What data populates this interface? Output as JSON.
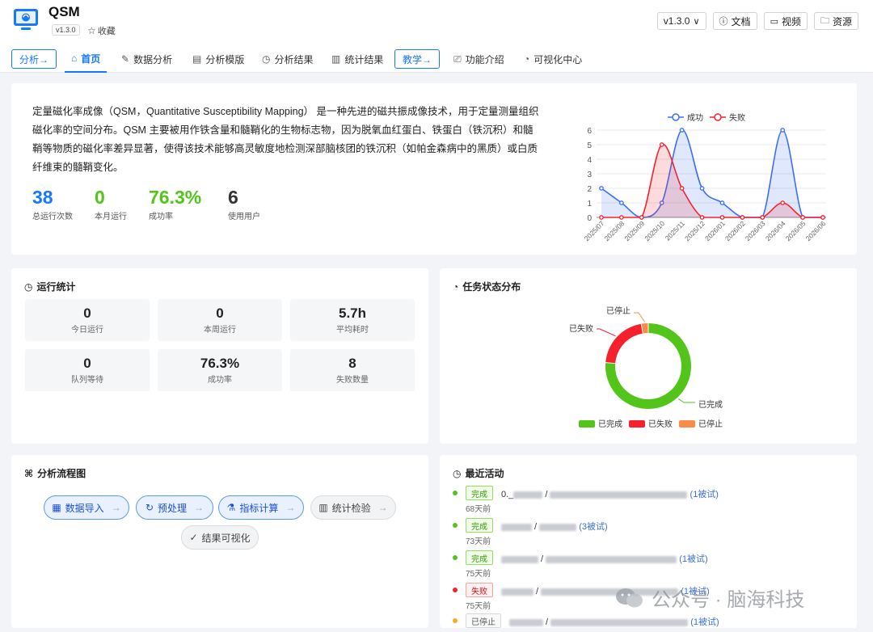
{
  "header": {
    "title": "QSM",
    "version_badge": "v1.3.0",
    "favorite_label": "收藏",
    "version_select": "v1.3.0",
    "docs_label": "文档",
    "video_label": "视频",
    "resources_label": "资源"
  },
  "nav": {
    "analysis_btn": "分析→",
    "home": "首页",
    "data_analysis": "数据分析",
    "analysis_template": "分析模版",
    "analysis_results": "分析结果",
    "stats_results": "统计结果",
    "teaching_btn": "教学→",
    "features": "功能介绍",
    "viz_center": "可视化中心"
  },
  "intro": {
    "description": "定量磁化率成像（QSM，Quantitative Susceptibility Mapping） 是一种先进的磁共振成像技术，用于定量测量组织磁化率的空间分布。QSM 主要被用作铁含量和髓鞘化的生物标志物，因为脱氧血红蛋白、铁蛋白（铁沉积）和髓鞘等物质的磁化率差异显著，使得该技术能够高灵敏度地检测深部脑核团的铁沉积（如帕金森病中的黑质）或白质纤维束的髓鞘变化。",
    "kpis": [
      {
        "value": "38",
        "label": "总运行次数",
        "color": "#1677ff"
      },
      {
        "value": "0",
        "label": "本月运行",
        "color": "#52c41a"
      },
      {
        "value": "76.3%",
        "label": "成功率",
        "color": "#52c41a"
      },
      {
        "value": "6",
        "label": "使用用户",
        "color": "#333333"
      }
    ]
  },
  "chart_data": {
    "type": "line",
    "categories": [
      "2025/07",
      "2025/08",
      "2025/09",
      "2025/10",
      "2025/11",
      "2025/12",
      "2026/01",
      "2026/02",
      "2026/03",
      "2026/04",
      "2026/05",
      "2026/06"
    ],
    "series": [
      {
        "name": "成功",
        "values": [
          2,
          1,
          0,
          1,
          6,
          2,
          1,
          0,
          0,
          6,
          0,
          0
        ],
        "color": "#3b6ff2"
      },
      {
        "name": "失败",
        "values": [
          0,
          0,
          0,
          5,
          2,
          0,
          0,
          0,
          0,
          1,
          0,
          0
        ],
        "color": "#f5222d"
      }
    ],
    "y_ticks": [
      "0",
      "1",
      "2",
      "3",
      "4",
      "5",
      "6"
    ],
    "ylim": [
      0,
      6
    ],
    "legend": "top-center",
    "grid": true
  },
  "run_stats": {
    "title": "运行统计",
    "items": [
      {
        "value": "0",
        "label": "今日运行"
      },
      {
        "value": "0",
        "label": "本周运行"
      },
      {
        "value": "5.7h",
        "label": "平均耗时"
      },
      {
        "value": "0",
        "label": "队列等待"
      },
      {
        "value": "76.3%",
        "label": "成功率"
      },
      {
        "value": "8",
        "label": "失败数量"
      }
    ]
  },
  "task_dist": {
    "title": "任务状态分布",
    "slices": [
      {
        "name": "已完成",
        "value": 29,
        "color": "#52c41a"
      },
      {
        "name": "已失败",
        "value": 8,
        "color": "#f5222d"
      },
      {
        "name": "已停止",
        "value": 1,
        "color": "#fa8c4a"
      }
    ]
  },
  "flow": {
    "title": "分析流程图",
    "nodes": [
      "数据导入",
      "预处理",
      "指标计算",
      "统计检验",
      "结果可视化"
    ]
  },
  "recent": {
    "title": "最近活动",
    "items": [
      {
        "status": "完成",
        "kind": "done",
        "prefix": "0._",
        "retry": "(1被试)",
        "time": "68天前",
        "dot": "#52c41a"
      },
      {
        "status": "完成",
        "kind": "done",
        "prefix": "",
        "retry": "(3被试)",
        "time": "73天前",
        "dot": "#52c41a"
      },
      {
        "status": "完成",
        "kind": "done",
        "prefix": "",
        "retry": "(1被试)",
        "time": "75天前",
        "dot": "#52c41a"
      },
      {
        "status": "失败",
        "kind": "fail",
        "prefix": "",
        "retry": "(1被试)",
        "time": "75天前",
        "dot": "#f5222d"
      },
      {
        "status": "已停止",
        "kind": "stop",
        "prefix": "",
        "retry": "(1被试)",
        "time": "",
        "dot": "#faad14"
      }
    ]
  },
  "watermark": {
    "text": "公众号 · 脑海科技"
  }
}
